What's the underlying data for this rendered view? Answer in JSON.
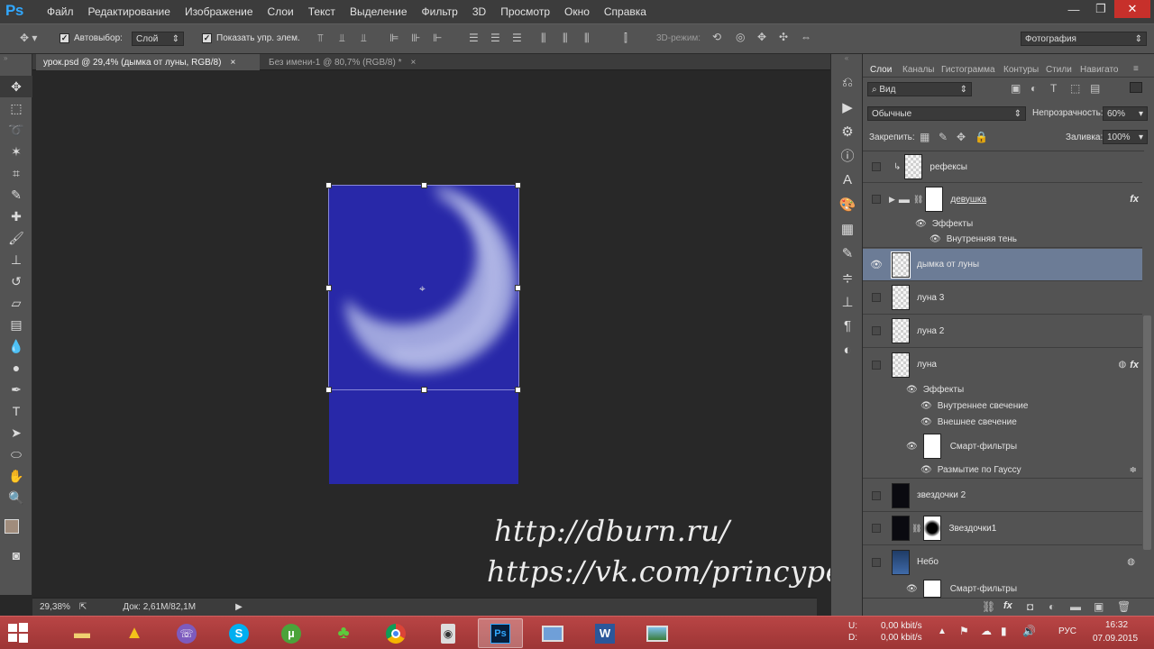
{
  "app": {
    "logo": "Ps"
  },
  "menu": [
    "Файл",
    "Редактирование",
    "Изображение",
    "Слои",
    "Текст",
    "Выделение",
    "Фильтр",
    "3D",
    "Просмотр",
    "Окно",
    "Справка"
  ],
  "window_controls": {
    "minimize": "—",
    "restore": "❐",
    "close": "✕"
  },
  "options": {
    "autoselect_label": "Автовыбор:",
    "autoselect_value": "Слой",
    "show_controls_label": "Показать упр. элем.",
    "mode3d_label": "3D-режим:",
    "workspace": "Фотография"
  },
  "tabs": [
    {
      "label": "урок.psd @ 29,4% (дымка от луны, RGB/8)",
      "close": "×"
    },
    {
      "label": "Без имени-1 @ 80,7% (RGB/8) *",
      "close": "×"
    }
  ],
  "status": {
    "zoom": "29,38%",
    "doc": "Док: 2,61M/82,1M"
  },
  "watermark": {
    "line1": "http://dburn.ru/",
    "line2": "https://vk.com/princypessa"
  },
  "panel": {
    "tabs": [
      "Слои",
      "Каналы",
      "Гистограмма",
      "Контуры",
      "Стили",
      "Навигато"
    ],
    "filter_kind": "Вид",
    "blend_mode": "Обычные",
    "opacity_label": "Непрозрачность:",
    "opacity_value": "60%",
    "lock_label": "Закрепить:",
    "fill_label": "Заливка:",
    "fill_value": "100%"
  },
  "layers": {
    "refleksy": "рефексы",
    "devushka": "девушка",
    "effects1": "Эффекты",
    "inner_shadow": "Внутренняя тень",
    "dymka": "дымка от луны",
    "luna3": "луна 3",
    "luna2": "луна 2",
    "luna": "луна",
    "effects2": "Эффекты",
    "inner_glow": "Внутреннее свечение",
    "outer_glow": "Внешнее свечение",
    "smart_filters1": "Смарт-фильтры",
    "gauss": "Размытие по Гауссу",
    "stars2": "звездочки 2",
    "stars1": "Звездочки1",
    "sky": "Небо",
    "smart_filters2": "Смарт-фильтры",
    "fx": "fx"
  },
  "taskbar": {
    "net_up_label": "U:",
    "net_down_label": "D:",
    "net_up": "0,00 kbit/s",
    "net_down": "0,00 kbit/s",
    "lang": "РУС",
    "time": "16:32",
    "date": "07.09.2015"
  },
  "colors": {
    "canvas_blue": "#2828a8",
    "selected_layer": "#6c7c96",
    "taskbar": "#a83b3b"
  }
}
